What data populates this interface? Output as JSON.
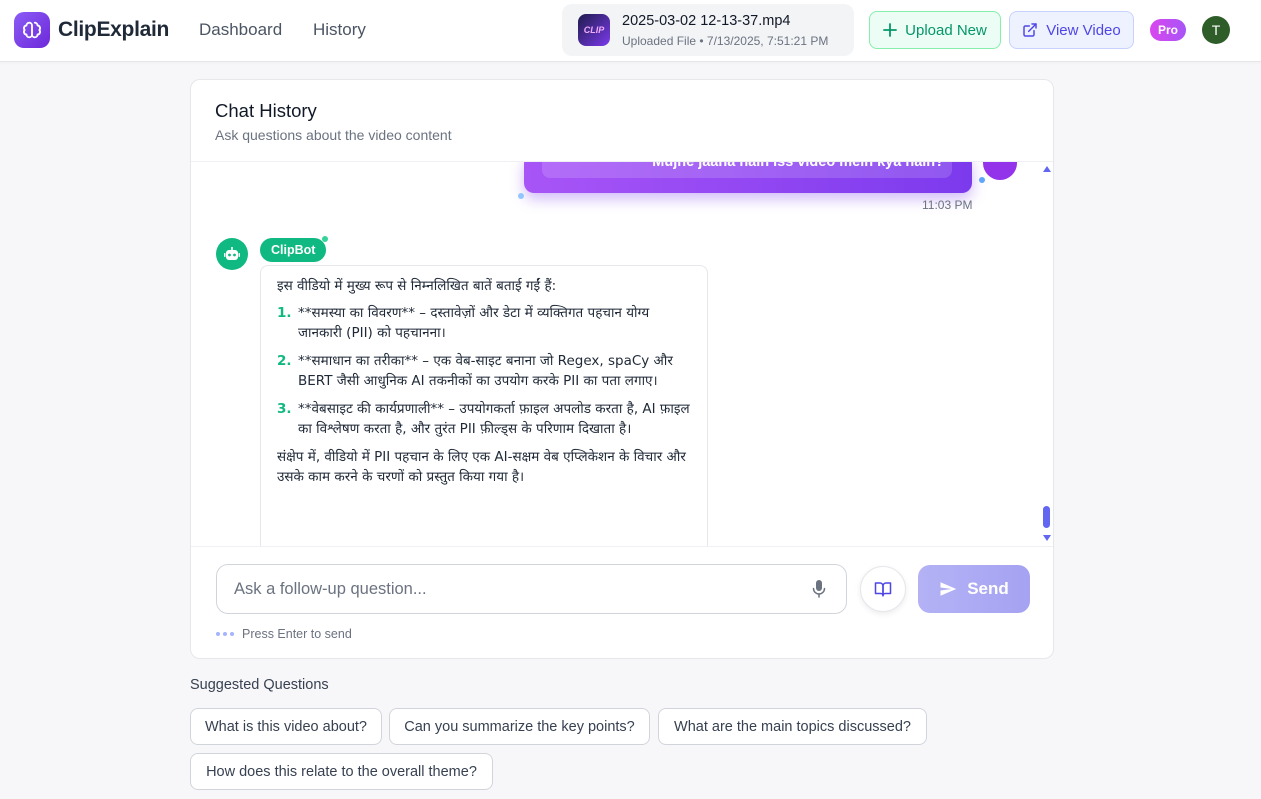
{
  "app": {
    "name": "ClipExplain"
  },
  "nav": {
    "dashboard": "Dashboard",
    "history": "History"
  },
  "file": {
    "thumb_text": "CLIP",
    "name": "2025-03-02 12-13-37.mp4",
    "meta": "Uploaded File • 7/13/2025, 7:51:21 PM"
  },
  "actions": {
    "upload": "Upload New",
    "view": "View Video"
  },
  "badge": {
    "plan": "Pro"
  },
  "user": {
    "initial": "T"
  },
  "chat": {
    "title": "Chat History",
    "subtitle": "Ask questions about the video content",
    "user_message": {
      "text": "Mujhe jaana hain iss video mein kya hain?",
      "time": "11:03 PM"
    },
    "bot": {
      "name": "ClipBot",
      "intro": "इस वीडियो में मुख्य रूप से निम्नलिखित बातें बताई गईं हैं:",
      "points": [
        {
          "num": "1.",
          "text": "**समस्या का विवरण** – दस्तावेज़ों और डेटा में व्यक्तिगत पहचान योग्य जानकारी (PII) को पहचानना।"
        },
        {
          "num": "2.",
          "text": "**समाधान का तरीका** – एक वेब-साइट बनाना जो Regex, spaCy और BERT जैसी आधुनिक AI तकनीकों का उपयोग करके PII का पता लगाए।"
        },
        {
          "num": "3.",
          "text": "**वेबसाइट की कार्यप्रणाली** – उपयोगकर्ता फ़ाइल अपलोड करता है, AI फ़ाइल का विश्लेषण करता है, और तुरंत PII फ़ील्ड्स के परिणाम दिखाता है।"
        }
      ],
      "summary": "संक्षेप में, वीडियो में PII पहचान के लिए एक AI-सक्षम वेब एप्लिकेशन के विचार और उसके काम करने के चरणों को प्रस्तुत किया गया है।"
    }
  },
  "input": {
    "placeholder": "Ask a follow-up question...",
    "value": "",
    "send_label": "Send",
    "hint": "Press Enter to send"
  },
  "suggestions": {
    "title": "Suggested Questions",
    "items": [
      "What is this video about?",
      "Can you summarize the key points?",
      "What are the main topics discussed?",
      "How does this relate to the overall theme?"
    ]
  },
  "colors": {
    "brand": "#7c3aed",
    "bot": "#10b981",
    "accent": "#6366f1",
    "upload": "#059669"
  },
  "icons": {
    "logo": "brain-icon",
    "upload": "plus-icon",
    "view": "external-link-icon",
    "mic": "microphone-icon",
    "book": "book-icon",
    "send": "paper-plane-icon",
    "bot": "robot-icon"
  }
}
